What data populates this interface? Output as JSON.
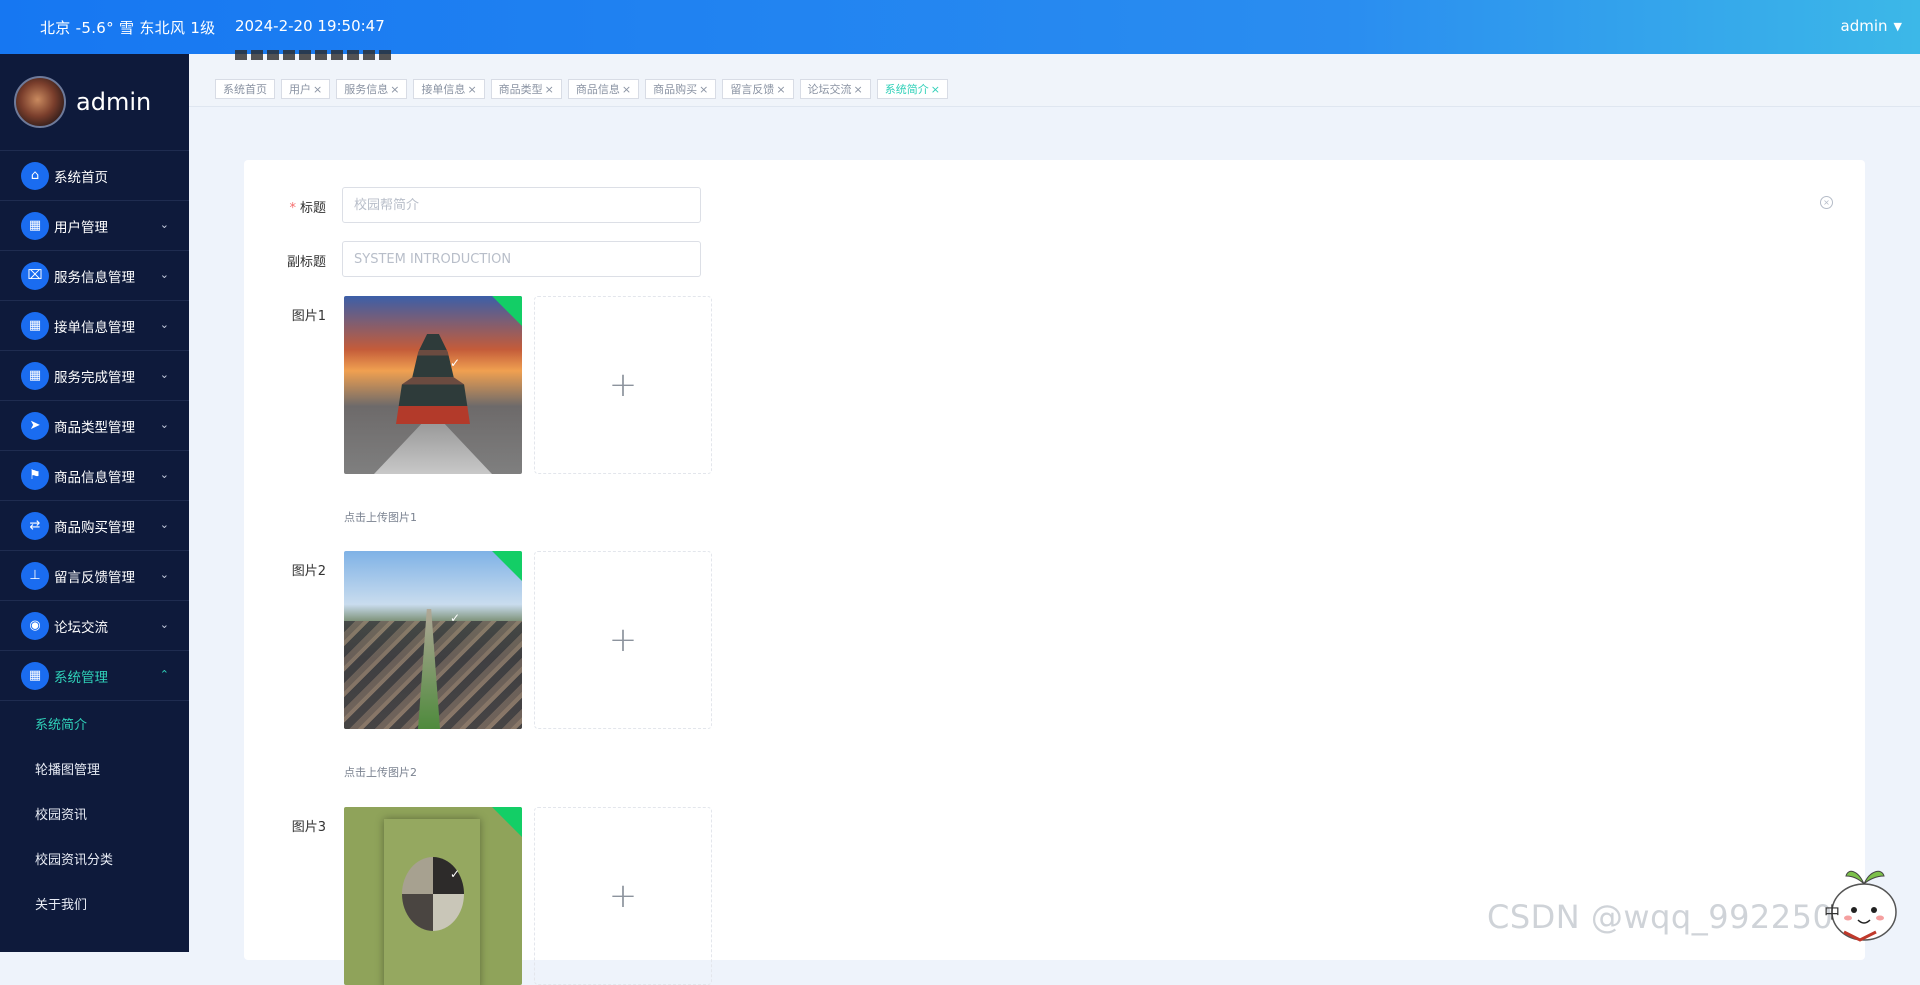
{
  "header": {
    "weather": "北京  -5.6°  雪  东北风  1级",
    "datetime": "2024-2-20 19:50:47",
    "user": "admin",
    "user_caret_icon": "caret-down-icon"
  },
  "sidebar": {
    "username": "admin",
    "menu": [
      {
        "label": "系统首页",
        "icon": "home-icon",
        "glyph": "⌂",
        "has_children": false
      },
      {
        "label": "用户管理",
        "icon": "grid-icon",
        "glyph": "▦",
        "has_children": true
      },
      {
        "label": "服务信息管理",
        "icon": "service-icon",
        "glyph": "⌧",
        "has_children": true
      },
      {
        "label": "接单信息管理",
        "icon": "grid-icon",
        "glyph": "▦",
        "has_children": true
      },
      {
        "label": "服务完成管理",
        "icon": "grid-icon",
        "glyph": "▦",
        "has_children": true
      },
      {
        "label": "商品类型管理",
        "icon": "send-icon",
        "glyph": "➤",
        "has_children": true
      },
      {
        "label": "商品信息管理",
        "icon": "flag-icon",
        "glyph": "⚑",
        "has_children": true
      },
      {
        "label": "商品购买管理",
        "icon": "transfer-icon",
        "glyph": "⇄",
        "has_children": true
      },
      {
        "label": "留言反馈管理",
        "icon": "stamp-icon",
        "glyph": "⊥",
        "has_children": true
      },
      {
        "label": "论坛交流",
        "icon": "location-icon",
        "glyph": "◉",
        "has_children": true
      },
      {
        "label": "系统管理",
        "icon": "grid-icon",
        "glyph": "▦",
        "has_children": true,
        "expanded": true
      }
    ],
    "submenu": [
      "系统简介",
      "轮播图管理",
      "校园资讯",
      "校园资讯分类",
      "关于我们"
    ],
    "active_sub": "系统简介",
    "accent": "#2fd0b8",
    "bg": "#0e1a3b"
  },
  "tags": [
    {
      "label": "系统首页",
      "closable": false
    },
    {
      "label": "用户",
      "closable": true
    },
    {
      "label": "服务信息",
      "closable": true
    },
    {
      "label": "接单信息",
      "closable": true
    },
    {
      "label": "商品类型",
      "closable": true
    },
    {
      "label": "商品信息",
      "closable": true
    },
    {
      "label": "商品购买",
      "closable": true
    },
    {
      "label": "留言反馈",
      "closable": true
    },
    {
      "label": "论坛交流",
      "closable": true
    },
    {
      "label": "系统简介",
      "closable": true,
      "active": true
    }
  ],
  "form": {
    "title_label": "标题",
    "title_required": "*",
    "title_value": "校园帮简介",
    "subtitle_label": "副标题",
    "subtitle_value": "SYSTEM INTRODUCTION",
    "pic1_label": "图片1",
    "pic1_tip": "点击上传图片1",
    "pic2_label": "图片2",
    "pic2_tip": "点击上传图片2",
    "pic3_label": "图片3",
    "upload_plus": "+",
    "check": "✓",
    "close": "×"
  },
  "watermark": "CSDN @wqq_992250977",
  "mascot_text": "中"
}
